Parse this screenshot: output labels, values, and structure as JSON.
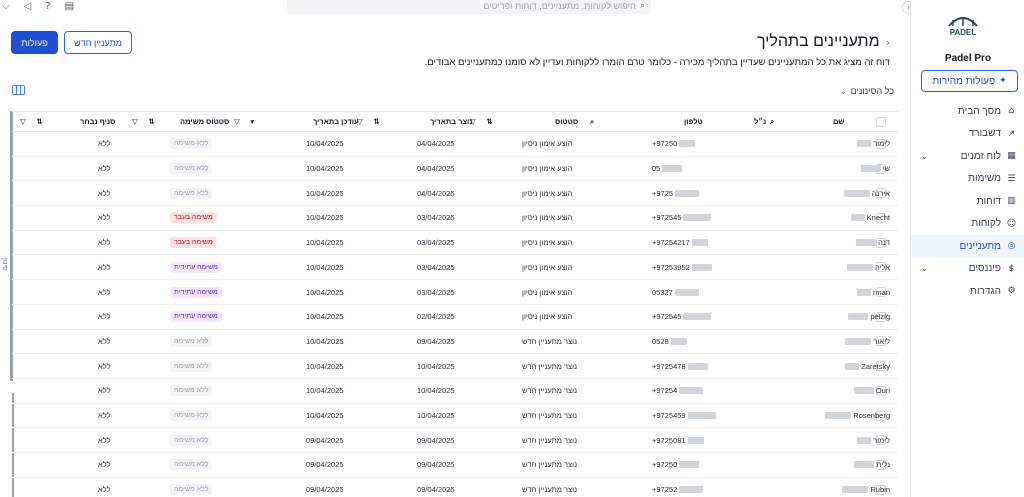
{
  "topbar": {
    "search_placeholder": "חיפוש לקוחות, מתעניינים, דוחות ופריטים"
  },
  "sidebar": {
    "brand": "Padel Pro",
    "logo_text": "PADEL",
    "quick_actions": "פעולות מהירות",
    "items": [
      {
        "label": "מסך הבית",
        "icon": "home-icon",
        "glyph": "⌂"
      },
      {
        "label": "דשבורד",
        "icon": "chart-line-icon",
        "glyph": "↗"
      },
      {
        "label": "לוח זמנים",
        "icon": "calendar-icon",
        "glyph": "▦",
        "expand": true
      },
      {
        "label": "משימות",
        "icon": "clipboard-icon",
        "glyph": "☰"
      },
      {
        "label": "דוחות",
        "icon": "bar-chart-icon",
        "glyph": "▥"
      },
      {
        "label": "לקוחות",
        "icon": "user-icon",
        "glyph": "☺"
      },
      {
        "label": "מתעניינים",
        "icon": "target-icon",
        "glyph": "◎",
        "active": true
      },
      {
        "label": "פיננסים",
        "icon": "dollar-icon",
        "glyph": "$",
        "expand": true
      },
      {
        "label": "הגדרות",
        "icon": "gear-icon",
        "glyph": "⚙"
      }
    ]
  },
  "main": {
    "title": "מתעניינים בתהליך",
    "description": "דוח זה מציג את כל המתעניינים שעדיין בתהליך מכירה - כלומר טרם הומרו ללקוחות ועדיין לא סומנו כמתעניינים אבודים.",
    "actions_label": "פעולות",
    "new_lead_label": "מתעניין חדש",
    "filters_label": "כל הסינונים",
    "side_tab": "סינון"
  },
  "table": {
    "headers": {
      "name": "שם",
      "owner": "נ״ל",
      "phone": "טלפון",
      "status": "סטטוס",
      "created": "נוצר בתאריך",
      "updated": "עודכן בתאריך",
      "task_status": "סטטוס משימה",
      "branch": "סניף נבחר"
    },
    "rows": [
      {
        "name": "לימור",
        "phone": "+97250",
        "status": "הוצע אימון ניסיון",
        "created": "04/04/2025",
        "updated": "10/04/2025",
        "task": "ללא משימה",
        "task_type": "none",
        "branch": "ללא"
      },
      {
        "name": "שי",
        "phone": "05",
        "status": "הוצע אימון ניסיון",
        "created": "04/04/2025",
        "updated": "10/04/2025",
        "task": "ללא משימה",
        "task_type": "none",
        "branch": "ללא"
      },
      {
        "name": "אירנה",
        "phone": "+9725",
        "status": "הוצע אימון ניסיון",
        "created": "04/04/2025",
        "updated": "10/04/2025",
        "task": "ללא משימה",
        "task_type": "none",
        "branch": "ללא"
      },
      {
        "name": "Knecht",
        "phone": "+972545",
        "status": "הוצע אימון ניסיון",
        "created": "03/04/2025",
        "updated": "10/04/2025",
        "task": "משימה בעבר",
        "task_type": "late",
        "branch": "ללא"
      },
      {
        "name": "דנה",
        "phone": "+97254217",
        "status": "הוצע אימון ניסיון",
        "created": "03/04/2025",
        "updated": "10/04/2025",
        "task": "משימה בעבר",
        "task_type": "late",
        "branch": "ללא"
      },
      {
        "name": "אליה",
        "phone": "+97253952",
        "status": "הוצע אימון ניסיון",
        "created": "03/04/2025",
        "updated": "10/04/2025",
        "task": "משימה עתידית",
        "task_type": "future",
        "branch": "ללא"
      },
      {
        "name": "rman",
        "phone": "05327",
        "status": "הוצע אימון ניסיון",
        "created": "03/04/2025",
        "updated": "10/04/2025",
        "task": "משימה עתידית",
        "task_type": "future",
        "branch": "ללא"
      },
      {
        "name": "pelzig",
        "phone": "+972545",
        "status": "הוצע אימון ניסיון",
        "created": "02/04/2025",
        "updated": "10/04/2025",
        "task": "משימה עתידית",
        "task_type": "future",
        "branch": "ללא"
      },
      {
        "name": "ליאור",
        "phone": "0528",
        "status": "נוצר מתעניין חדש",
        "created": "09/04/2025",
        "updated": "10/04/2025",
        "task": "ללא משימה",
        "task_type": "none",
        "branch": "ללא"
      },
      {
        "name": "Zaretsky",
        "phone": "+9725478",
        "status": "נוצר מתעניין חדש",
        "created": "10/04/2025",
        "updated": "10/04/2025",
        "task": "ללא משימה",
        "task_type": "none",
        "branch": "ללא"
      },
      {
        "name": "Ouri",
        "phone": "+97254",
        "status": "נוצר מתעניין חדש",
        "created": "10/04/2025",
        "updated": "10/04/2025",
        "task": "ללא משימה",
        "task_type": "none",
        "branch": "ללא"
      },
      {
        "name": "Rosenberg",
        "phone": "+9725459",
        "status": "נוצר מתעניין חדש",
        "created": "10/04/2025",
        "updated": "10/04/2025",
        "task": "ללא משימה",
        "task_type": "none",
        "branch": "ללא"
      },
      {
        "name": "לימור",
        "phone": "+9725081",
        "status": "נוצר מתעניין חדש",
        "created": "09/04/2025",
        "updated": "09/04/2025",
        "task": "ללא משימה",
        "task_type": "none",
        "branch": "ללא"
      },
      {
        "name": "נלית",
        "phone": "+97250",
        "status": "נוצר מתעניין חדש",
        "created": "09/04/2025",
        "updated": "09/04/2025",
        "task": "ללא משימה",
        "task_type": "none",
        "branch": "ללא"
      },
      {
        "name": "Rubin",
        "phone": "+97252",
        "status": "נוצר מתעניין חדש",
        "created": "09/04/2025",
        "updated": "09/04/2025",
        "task": "ללא משימה",
        "task_type": "none",
        "branch": "ללא"
      }
    ]
  }
}
